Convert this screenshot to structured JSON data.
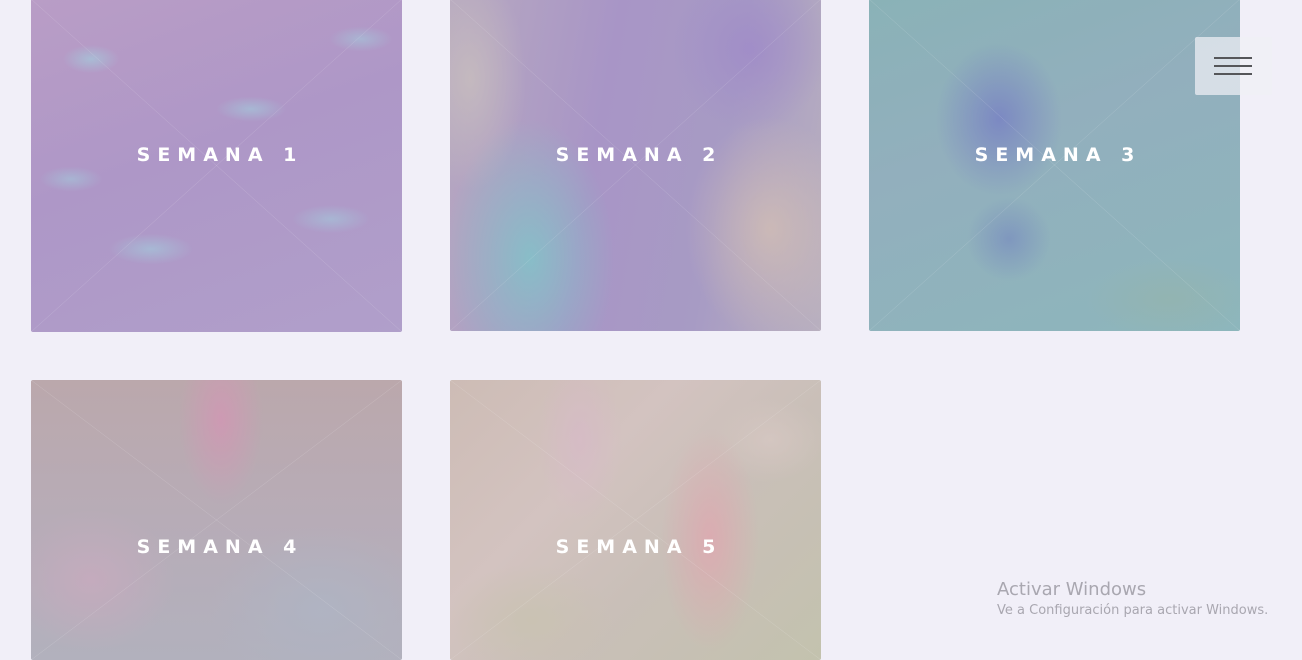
{
  "cards": [
    {
      "label": "SEMANA 1"
    },
    {
      "label": "SEMANA 2"
    },
    {
      "label": "SEMANA 3"
    },
    {
      "label": "SEMANA 4"
    },
    {
      "label": "SEMANA 5"
    }
  ],
  "menu": {
    "icon": "hamburger-menu-icon"
  },
  "watermark": {
    "title": "Activar Windows",
    "subtitle": "Ve a Configuración para activar Windows."
  },
  "colors": {
    "background": "#f1eff8",
    "label_text": "#ffffff",
    "menu_bars": "#555659",
    "watermark_text": "#a9a7b0"
  }
}
